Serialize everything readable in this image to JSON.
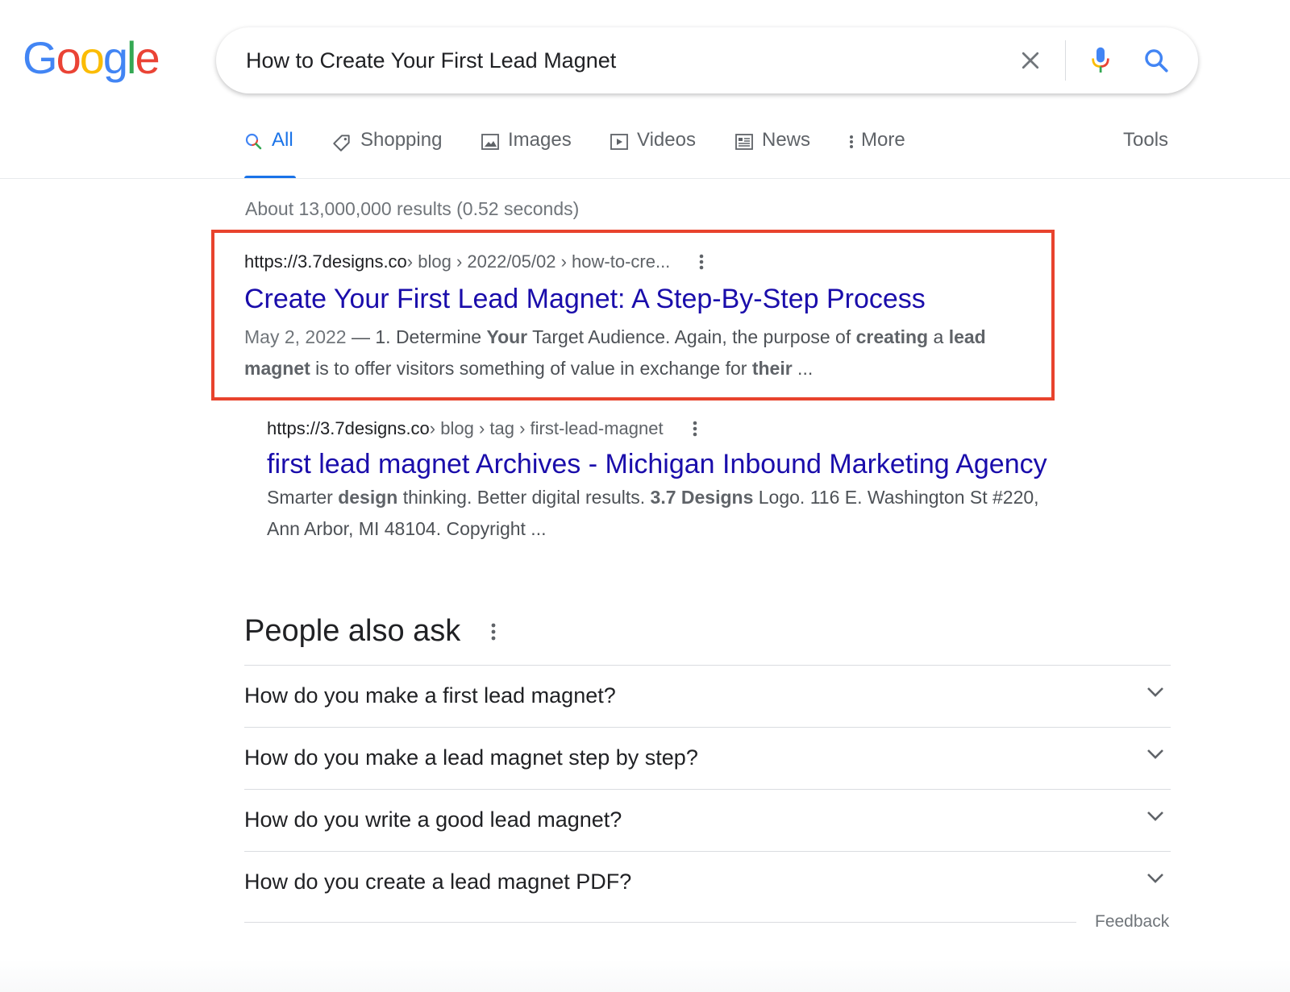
{
  "logo": {
    "letters": [
      "G",
      "o",
      "o",
      "g",
      "l",
      "e"
    ],
    "colors": [
      "#4285F4",
      "#EA4335",
      "#FBBC05",
      "#4285F4",
      "#34A853",
      "#EA4335"
    ]
  },
  "search": {
    "query": "How to Create Your First Lead Magnet",
    "icons": [
      "close-icon",
      "microphone-icon",
      "search-icon"
    ]
  },
  "tabs": [
    {
      "label": "All",
      "icon": "search-icon",
      "active": true
    },
    {
      "label": "Shopping",
      "icon": "tag-icon"
    },
    {
      "label": "Images",
      "icon": "image-icon"
    },
    {
      "label": "Videos",
      "icon": "play-icon"
    },
    {
      "label": "News",
      "icon": "newspaper-icon"
    },
    {
      "label": "More",
      "icon": "more-vert-icon"
    }
  ],
  "tools_label": "Tools",
  "stats": "About 13,000,000 results (0.52 seconds)",
  "results": [
    {
      "site": "https://3.7designs.co",
      "path": " › blog › 2022/05/02 › how-to-cre...",
      "title": "Create Your First Lead Magnet: A Step-By-Step Process",
      "date": "May 2, 2022",
      "snippet_parts": [
        " — 1. Determine ",
        "Your",
        " Target Audience. Again, the purpose of ",
        "creating",
        " a ",
        "lead",
        " ",
        "magnet",
        " is to offer visitors something of value in exchange for ",
        "their",
        " ..."
      ],
      "highlighted": true
    },
    {
      "site": "https://3.7designs.co",
      "path": " › blog › tag › first-lead-magnet",
      "title": "first lead magnet Archives - Michigan Inbound Marketing Agency",
      "snippet_parts": [
        "Smarter ",
        "design",
        " thinking. Better digital results. ",
        "3.7 Designs",
        " Logo. 116 E. Washington St #220,",
        " Ann Arbor, MI 48104. Copyright ..."
      ]
    }
  ],
  "people_also_ask": {
    "title": "People also ask",
    "questions": [
      "How do you make a first lead magnet?",
      "How do you make a lead magnet step by step?",
      "How do you write a good lead magnet?",
      "How do you create a lead magnet PDF?"
    ]
  },
  "feedback_label": "Feedback",
  "colors": {
    "link": "#1a0dab",
    "accent": "#1a73e8",
    "highlight_border": "#e8432d"
  }
}
